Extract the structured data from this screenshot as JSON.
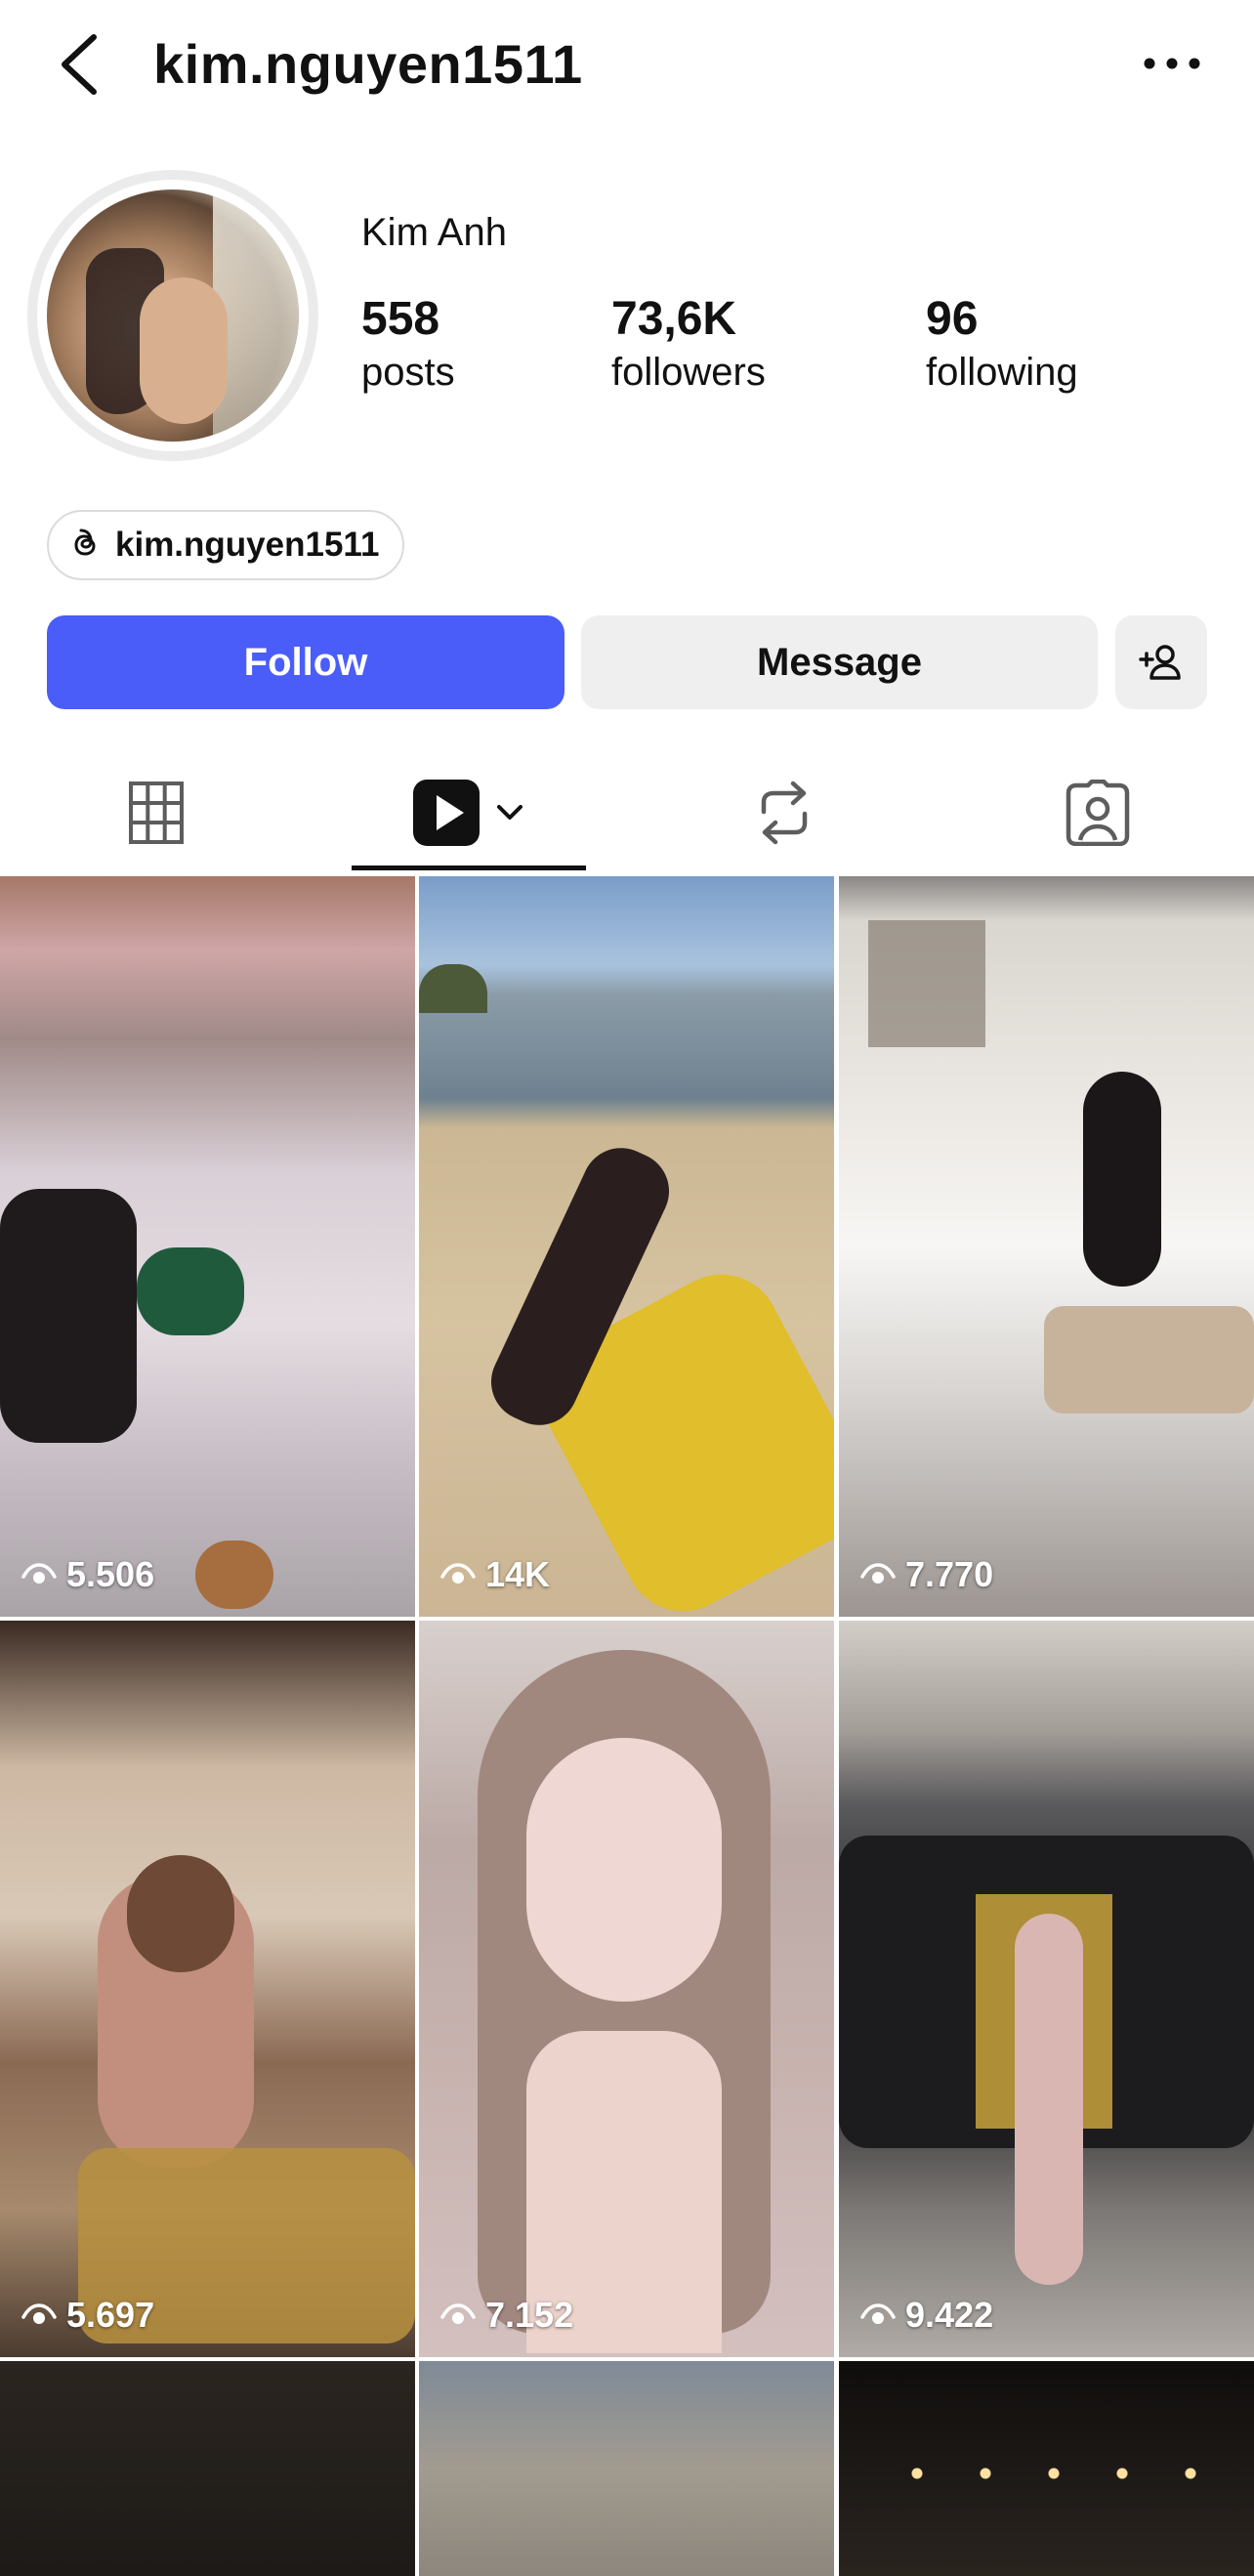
{
  "header": {
    "username": "kim.nguyen1511"
  },
  "profile": {
    "display_name": "Kim Anh",
    "stats": {
      "posts": {
        "value": "558",
        "label": "posts"
      },
      "followers": {
        "value": "73,6K",
        "label": "followers"
      },
      "following": {
        "value": "96",
        "label": "following"
      }
    },
    "threads_handle": "kim.nguyen1511"
  },
  "actions": {
    "follow_label": "Follow",
    "message_label": "Message"
  },
  "tabs": [
    {
      "icon": "grid-icon",
      "selected": false
    },
    {
      "icon": "reels-icon",
      "selected": true
    },
    {
      "icon": "reposts-icon",
      "selected": false
    },
    {
      "icon": "tagged-icon",
      "selected": false
    }
  ],
  "reels": [
    {
      "views": "5.506"
    },
    {
      "views": "14K"
    },
    {
      "views": "7.770"
    },
    {
      "views": "5.697"
    },
    {
      "views": "7.152"
    },
    {
      "views": "9.422"
    }
  ],
  "colors": {
    "follow_button": "#4a5df9",
    "secondary_button": "#efefef"
  }
}
